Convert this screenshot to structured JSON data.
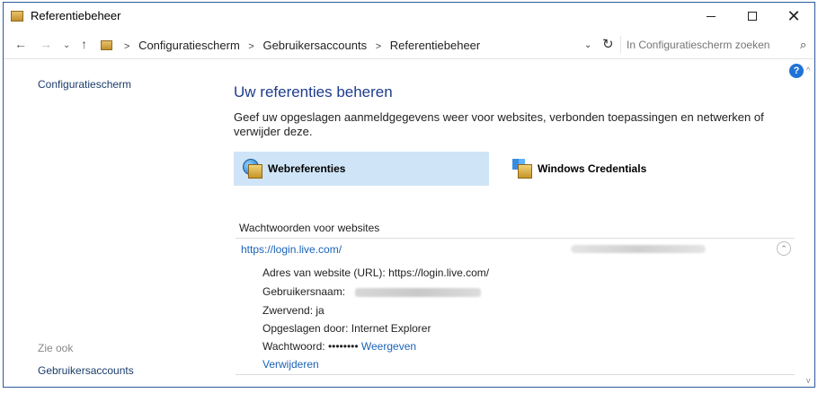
{
  "window": {
    "title": "Referentiebeheer",
    "controls": {
      "minimize": "—",
      "maximize": "☐",
      "close": "✕"
    }
  },
  "navbar": {
    "back": "←",
    "forward": "→",
    "recent": "⌄",
    "up": "↑",
    "breadcrumbs": [
      "Configuratiescherm",
      "Gebruikersaccounts",
      "Referentiebeheer"
    ],
    "breadcrumb_separator": ">",
    "refresh": "↻",
    "search_placeholder": "In Configuratiescherm zoeken"
  },
  "sidebar": {
    "home_link": "Configuratiescherm",
    "see_also": "Zie ook",
    "user_accounts": "Gebruikersaccounts"
  },
  "main": {
    "title": "Uw referenties beheren",
    "description": "Geef uw opgeslagen aanmeldgegevens weer voor websites, verbonden toepassingen en netwerken of verwijder deze.",
    "tiles": [
      {
        "label": "Webreferenties",
        "selected": true
      },
      {
        "label": "Windows Credentials",
        "selected": false
      }
    ],
    "section_label": "Wachtwoorden voor websites",
    "entry": {
      "url": "https://login.live.com/",
      "details": {
        "url_label": "Adres van website (URL):",
        "url_value": "https://login.live.com/",
        "username_label": "Gebruikersnaam:",
        "roaming_label": "Zwervend:",
        "roaming_value": "ja",
        "saved_by_label": "Opgeslagen door:",
        "saved_by_value": "Internet Explorer",
        "password_label": "Wachtwoord:",
        "password_value": "••••••••",
        "show_link": "Weergeven"
      },
      "remove_link": "Verwijderen"
    }
  },
  "colors": {
    "title_blue": "#1e3c8c",
    "link_blue": "#1a63b8",
    "selected_tile": "#cfe5f7"
  }
}
